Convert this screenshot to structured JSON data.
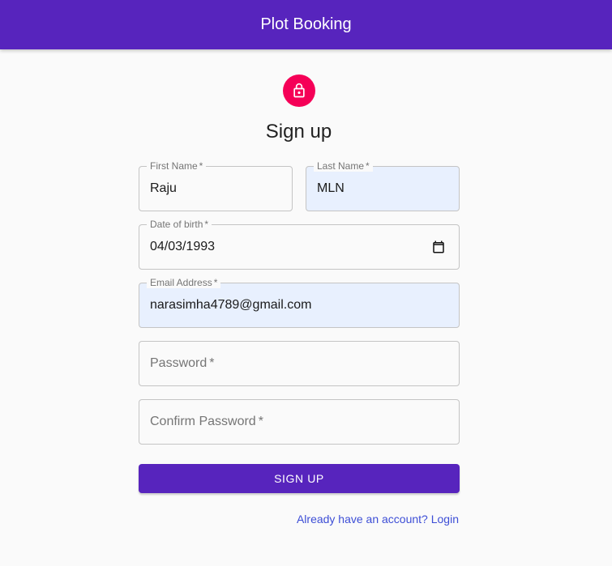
{
  "appbar": {
    "title": "Plot Booking"
  },
  "form": {
    "title": "Sign up",
    "first_name": {
      "label": "First Name",
      "value": "Raju"
    },
    "last_name": {
      "label": "Last Name",
      "value": "MLN"
    },
    "dob": {
      "label": "Date of birth",
      "value": "04/03/1993"
    },
    "email": {
      "label": "Email Address",
      "value": "narasimha4789@gmail.com"
    },
    "password": {
      "placeholder": "Password"
    },
    "confirm_password": {
      "placeholder": "Confirm Password"
    },
    "required_mark": "*",
    "submit_label": "SIGN UP",
    "login_link": "Already have an account? Login"
  },
  "icons": {
    "avatar": "lock-icon",
    "dob": "calendar-icon"
  },
  "colors": {
    "primary": "#5724bd",
    "avatar": "#f50057",
    "autofill": "#e8f0fe",
    "link": "#3d4ed6"
  }
}
